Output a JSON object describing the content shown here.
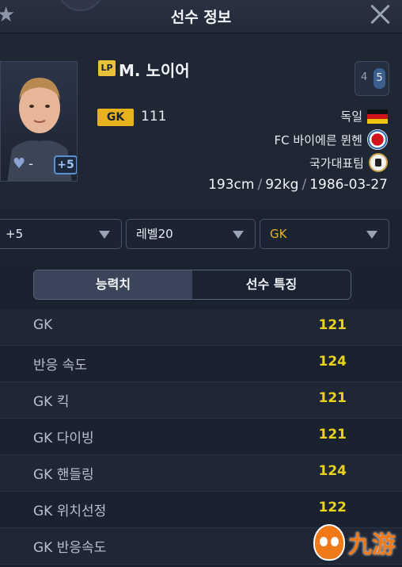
{
  "header": {
    "title": "선수 정보"
  },
  "player": {
    "name": "M. 노이어",
    "lp_badge": "LP",
    "position_numbers": [
      "4",
      "5"
    ],
    "plus_badge": "+5",
    "like_value": "-",
    "position": "GK",
    "overall": "111",
    "nation": "독일",
    "club": "FC 바이에른 뮌헨",
    "national_team": "국가대표팀",
    "height": "193cm",
    "weight": "92kg",
    "birthdate": "1986-03-27"
  },
  "dropdowns": {
    "enhance": "+5",
    "level": "레벨20",
    "position": "GK"
  },
  "tabs": [
    {
      "label": "능력치",
      "active": true
    },
    {
      "label": "선수 특징",
      "active": false
    }
  ],
  "stats": [
    {
      "label": "GK",
      "value": "121"
    },
    {
      "label": "반응 속도",
      "value": "124"
    },
    {
      "label": "GK 킥",
      "value": "121"
    },
    {
      "label": "GK 다이빙",
      "value": "121"
    },
    {
      "label": "GK 핸들링",
      "value": "124"
    },
    {
      "label": "GK 위치선정",
      "value": "122"
    },
    {
      "label": "GK 반응속도",
      "value": ""
    }
  ],
  "watermark": {
    "text": "九游"
  },
  "colors": {
    "gold": "#e8b21e",
    "stat_value": "#e8d21e",
    "background": "#1b2230"
  }
}
